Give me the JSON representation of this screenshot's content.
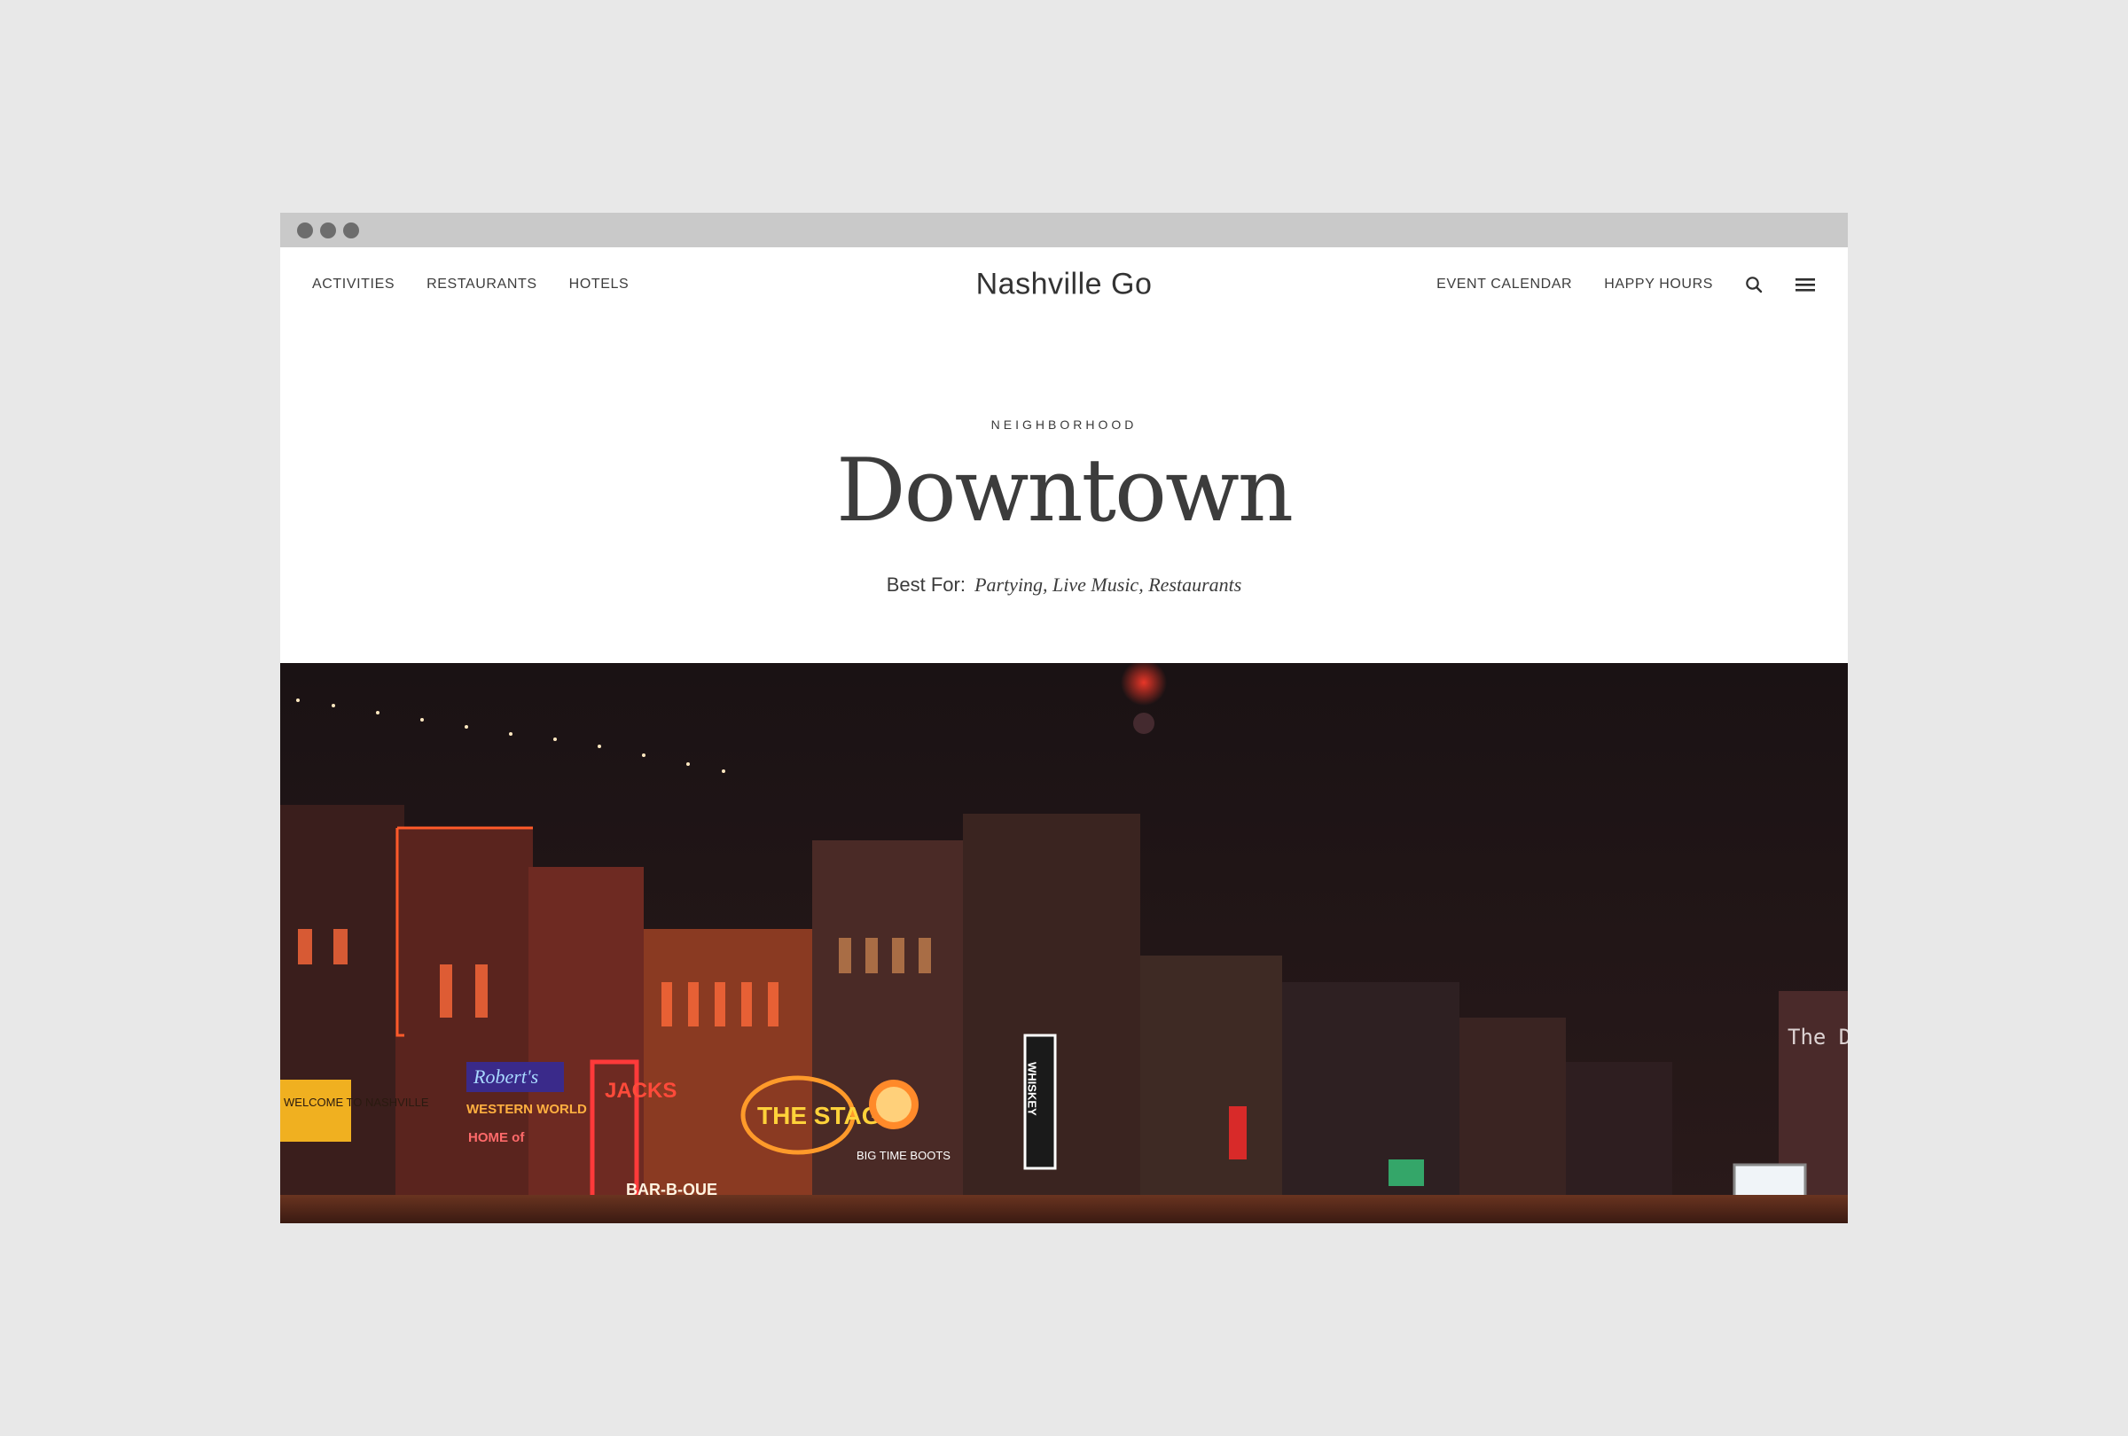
{
  "window": {
    "controls": [
      "close",
      "minimize",
      "maximize"
    ]
  },
  "nav": {
    "left_links": [
      "ACTIVITIES",
      "RESTAURANTS",
      "HOTELS"
    ],
    "logo": "Nashville Go",
    "right_links": [
      "EVENT CALENDAR",
      "HAPPY HOURS"
    ],
    "icons": [
      "search-icon",
      "menu-icon"
    ]
  },
  "hero": {
    "eyebrow": "NEIGHBORHOOD",
    "title": "Downtown",
    "best_for_label": "Best For:",
    "best_for_values": "Partying, Live Music, Restaurants"
  },
  "photo": {
    "signs": [
      "Robert's",
      "WESTERN WORLD",
      "HOME of",
      "JACKS",
      "BAR-B-QUE",
      "THE STAGE",
      "BIG TIME BOOTS",
      "WHISKEY",
      "The D",
      "WELCOME TO NASHVILLE"
    ]
  },
  "colors": {
    "page_bg": "#e8e8e8",
    "titlebar": "#c9c9c9",
    "text": "#3c3c3c",
    "night_sky": "#1d1416"
  }
}
